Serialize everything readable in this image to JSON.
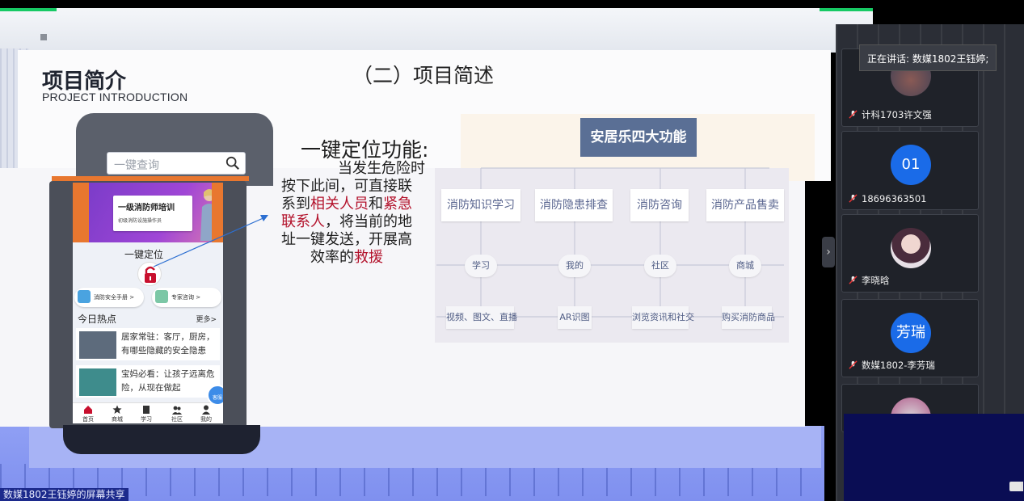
{
  "slide": {
    "title": "项目简介",
    "subtitle": "PROJECT INTRODUCTION",
    "section_heading": "（二）项目简述",
    "feature": {
      "title": "一键定位功能:",
      "lines": [
        [
          {
            "t": "当发生危险时",
            "red": false
          }
        ],
        [
          {
            "t": "按下此间，可直接联",
            "red": false
          }
        ],
        [
          {
            "t": "系到",
            "red": false
          },
          {
            "t": "相关人员",
            "red": true
          },
          {
            "t": "和",
            "red": false
          },
          {
            "t": "紧急",
            "red": true
          }
        ],
        [
          {
            "t": "联系人",
            "red": true
          },
          {
            "t": "，将当前的地",
            "red": false
          }
        ],
        [
          {
            "t": "址一键发送，开展高",
            "red": false
          }
        ],
        [
          {
            "t": "效率的",
            "red": false
          },
          {
            "t": "救援",
            "red": true
          }
        ]
      ]
    },
    "phone": {
      "search_placeholder": "一键查询",
      "banner_title": "一级消防师培训",
      "banner_subtitle": "初级消防设施操作员",
      "locate_label": "一键定位",
      "quick_buttons": [
        "消防安全手册 >",
        "专家咨询 >"
      ],
      "hot_heading": "今日热点",
      "hot_more": "更多>",
      "news": [
        "居家常驻：客厅，厨房，有哪些隐藏的安全隐患",
        "宝妈必看：让孩子远离危险，从现在做起"
      ],
      "float_button": "客服",
      "tabs": [
        "首页",
        "商城",
        "学习",
        "社区",
        "我的"
      ]
    },
    "diagram": {
      "header": "安居乐四大功能",
      "categories": [
        "消防知识学习",
        "消防隐患排查",
        "消防咨询",
        "消防产品售卖"
      ],
      "subs": [
        "学习",
        "我的",
        "社区",
        "商城"
      ],
      "details": [
        "视频、图文、直播",
        "AR识图",
        "浏览资讯和社交",
        "购买消防商品"
      ]
    }
  },
  "meeting": {
    "speaking_now": "正在讲话: 数媒1802王钰婷;",
    "participants": [
      {
        "name": "计科1703许文强",
        "avatar": "photo",
        "avatar_text": ""
      },
      {
        "name": "18696363501",
        "avatar": "text",
        "avatar_text": "01"
      },
      {
        "name": "李晓晗",
        "avatar": "photo",
        "avatar_text": ""
      },
      {
        "name": "数媒1802-李芳瑞",
        "avatar": "text",
        "avatar_text": "芳瑞"
      },
      {
        "name": "",
        "avatar": "photo",
        "avatar_text": ""
      }
    ]
  },
  "share_label": "数媒1802王钰婷的屏幕共享",
  "colors": {
    "accent_blue": "#1a6be8",
    "diagram_header": "#5a6f95",
    "highlight_red": "#b3122b",
    "share_bar": "#1c2a8c"
  }
}
